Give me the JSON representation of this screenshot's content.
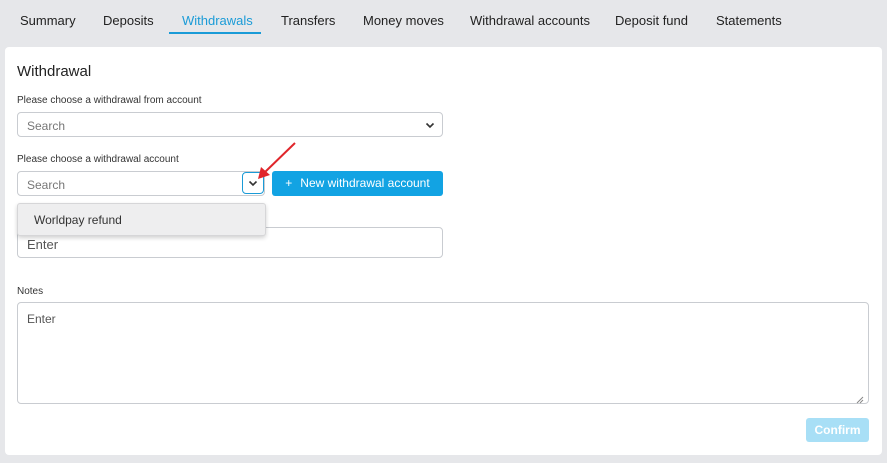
{
  "tabs": [
    {
      "label": "Summary"
    },
    {
      "label": "Deposits"
    },
    {
      "label": "Withdrawals",
      "active": true
    },
    {
      "label": "Transfers"
    },
    {
      "label": "Money moves"
    },
    {
      "label": "Withdrawal accounts"
    },
    {
      "label": "Deposit fund"
    },
    {
      "label": "Statements"
    }
  ],
  "form": {
    "title": "Withdrawal",
    "from_account": {
      "label": "Please choose a withdrawal from account",
      "placeholder": "Search"
    },
    "withdrawal_account": {
      "label": "Please choose a withdrawal account",
      "placeholder": "Search",
      "new_button_label": "New withdrawal account",
      "dropdown_options": [
        "Worldpay refund"
      ]
    },
    "amount": {
      "placeholder": "Enter"
    },
    "notes": {
      "label": "Notes",
      "placeholder": "Enter"
    },
    "confirm_label": "Confirm"
  },
  "colors": {
    "accent": "#1a9bd7",
    "button": "#12a3e3",
    "confirm_disabled": "#a8dff6",
    "annotation_arrow": "#e0262b"
  },
  "icons": {
    "dropdown_chevron": "chevron-down-icon",
    "plus": "plus-icon",
    "annotation": "red-arrow-icon"
  }
}
